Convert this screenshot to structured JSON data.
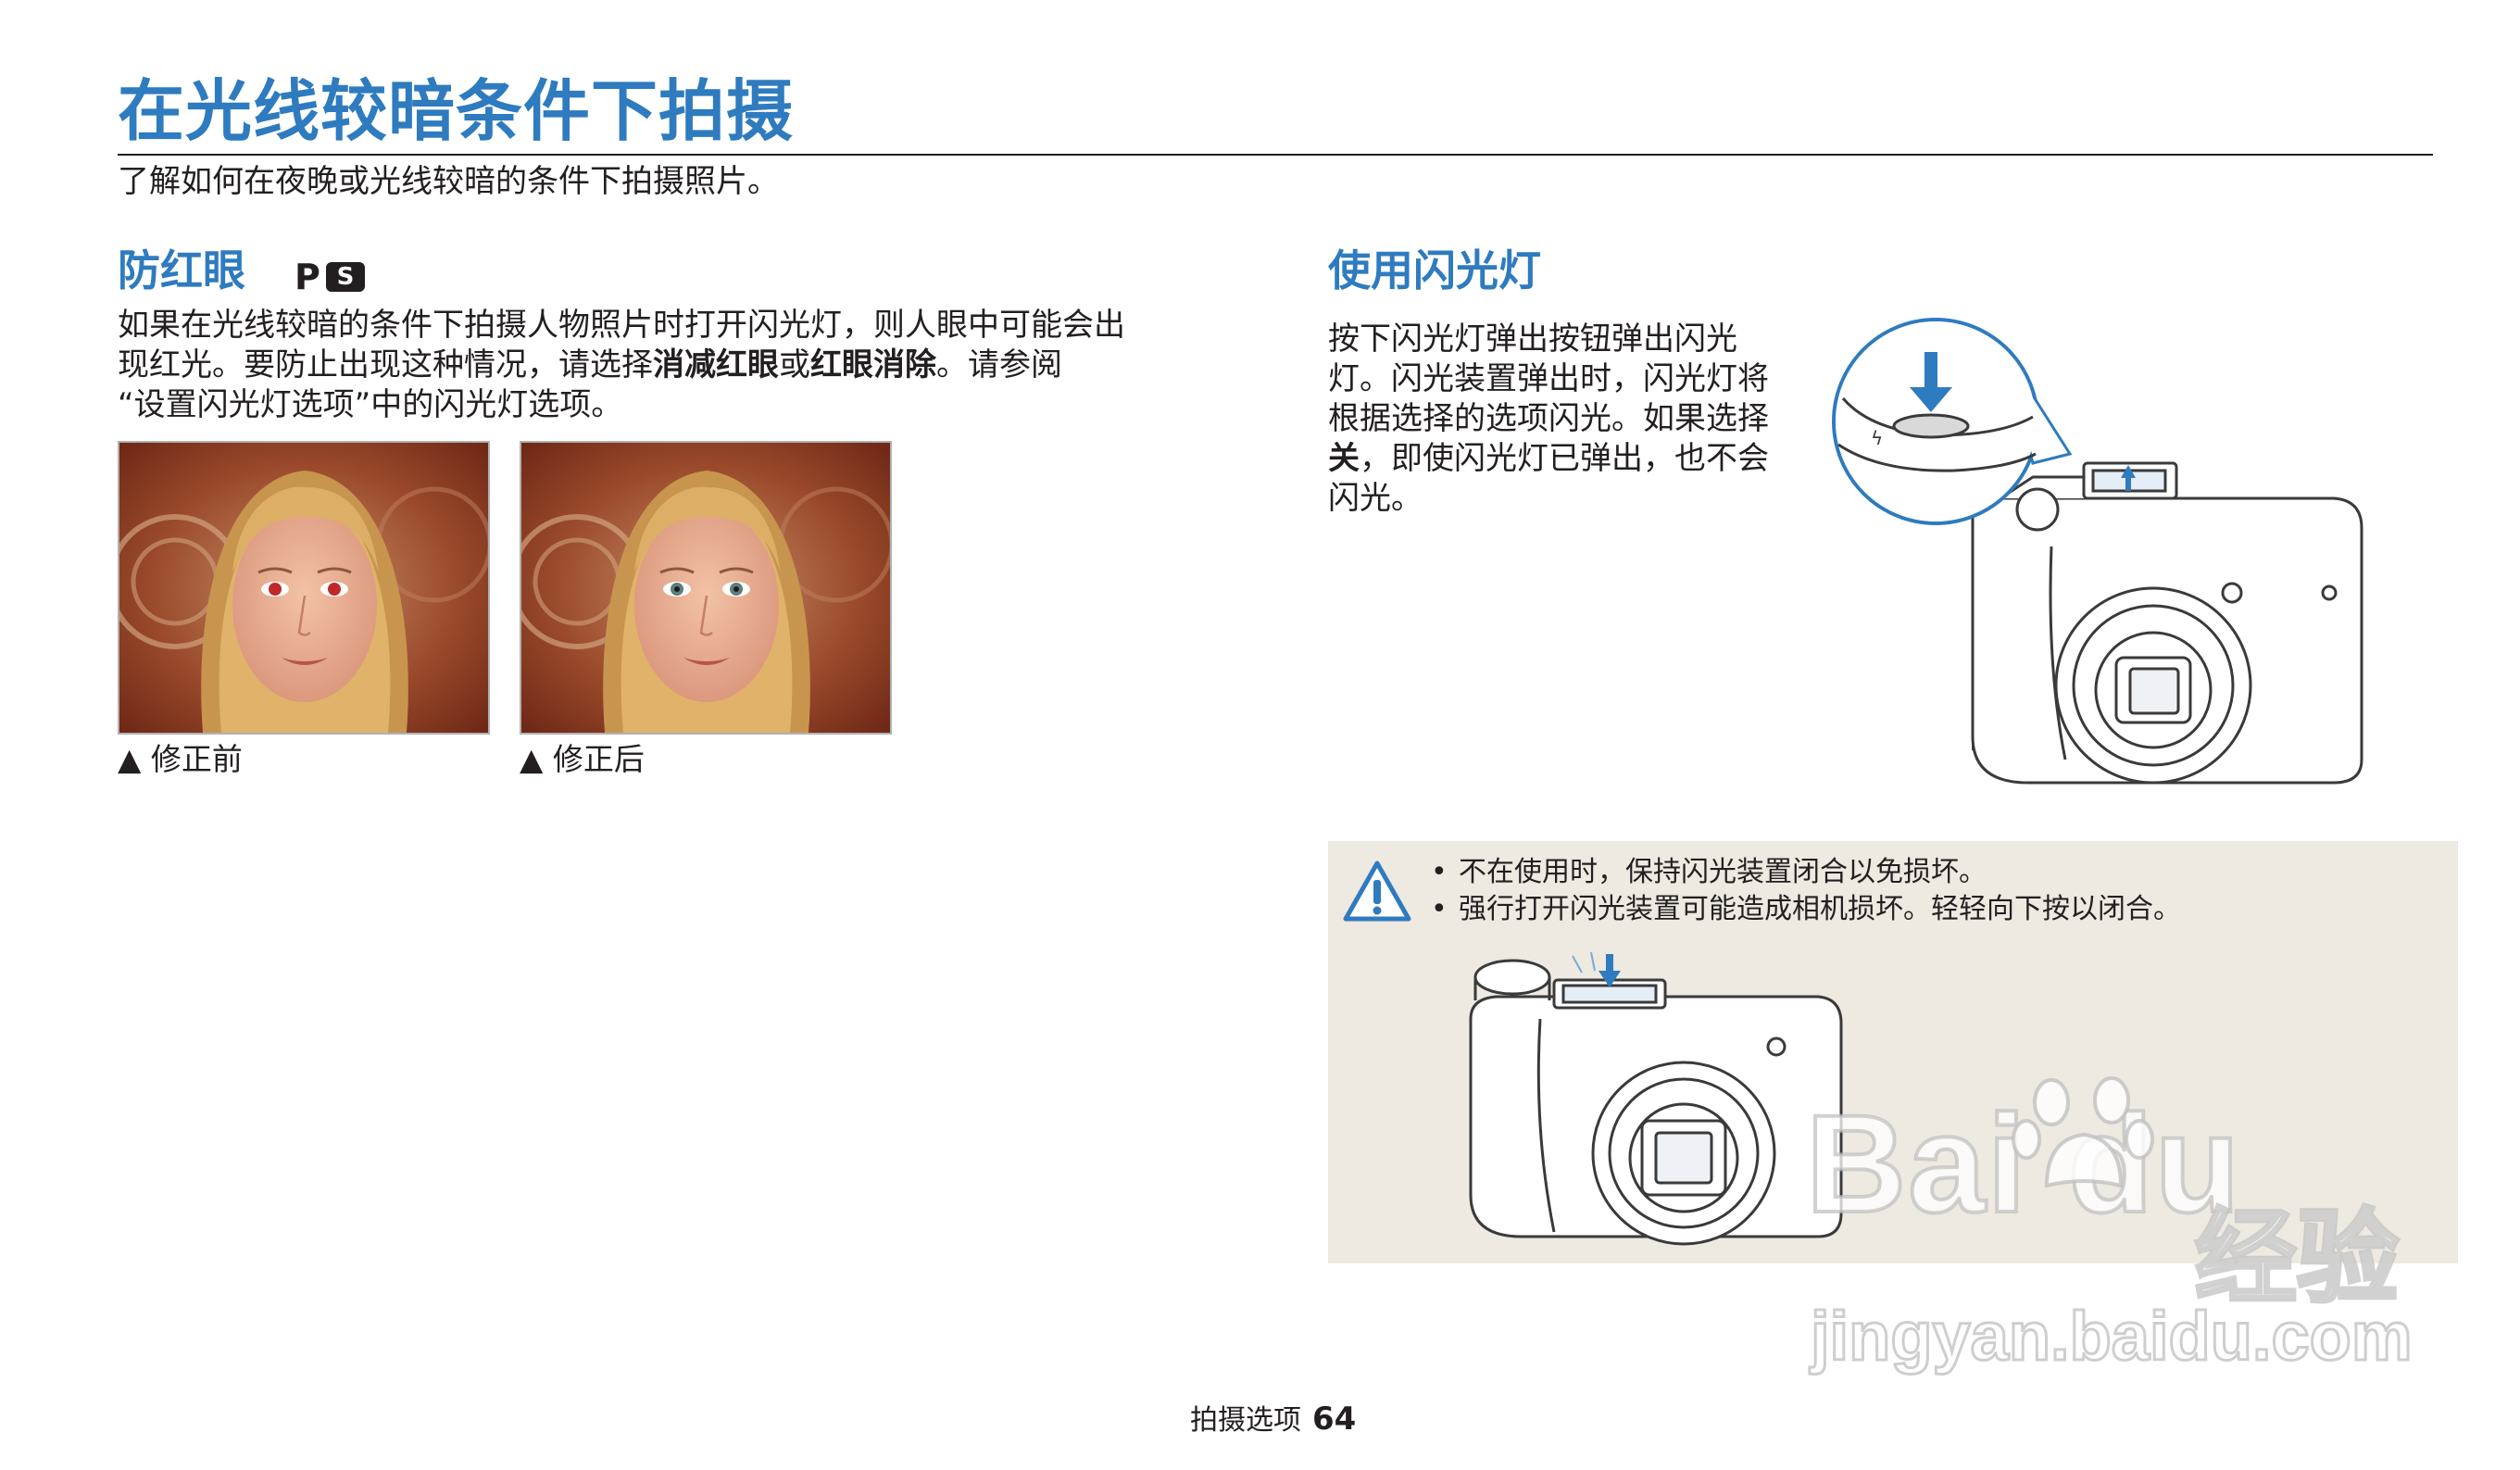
{
  "header": {
    "title": "在光线较暗条件下拍摄",
    "subtitle": "了解如何在夜晚或光线较暗的条件下拍摄照片。"
  },
  "redeye": {
    "heading": "防红眼",
    "mode_p": "P",
    "mode_s": "S",
    "para_line1": "如果在光线较暗的条件下拍摄人物照片时打开闪光灯，则人眼中可能会出",
    "para_line2_a": "现红光。要防止出现这种情况，请选择",
    "para_line2_bold1": "消减红眼",
    "para_line2_or": "或",
    "para_line2_bold2": "红眼消除",
    "para_line2_b": "。请参阅",
    "para_line3": "“设置闪光灯选项”中的闪光灯选项。",
    "caption_before": "▲ 修正前",
    "caption_after": "▲ 修正后"
  },
  "flash": {
    "heading": "使用闪光灯",
    "line1": "按下闪光灯弹出按钮弹出闪光",
    "line2": "灯。闪光装置弹出时，闪光灯将",
    "line3": "根据选择的选项闪光。如果选择",
    "line4_bold": "关",
    "line4_rest": "，即使闪光灯已弹出，也不会",
    "line5": "闪光。"
  },
  "warning": {
    "items": [
      "不在使用时，保持闪光装置闭合以免损坏。",
      "强行打开闪光装置可能造成相机损坏。轻轻向下按以闭合。"
    ]
  },
  "footer": {
    "section": "拍摄选项",
    "page": "64"
  },
  "watermark": {
    "logo": "Bai du",
    "cn": "经验",
    "url": "jingyan.baidu.com"
  },
  "colors": {
    "accent": "#2e7bbf",
    "text": "#231f20",
    "warn_bg": "#eee9e1"
  }
}
